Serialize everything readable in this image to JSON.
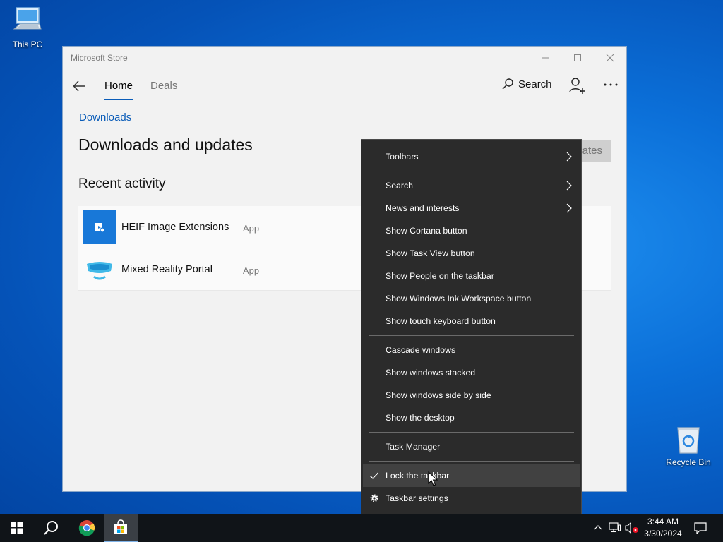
{
  "desktop": {
    "icons": [
      {
        "label": "This PC"
      },
      {
        "label": "Recycle Bin"
      }
    ]
  },
  "store": {
    "window_title": "Microsoft Store",
    "nav": {
      "tabs": [
        {
          "label": "Home",
          "active": true
        },
        {
          "label": "Deals",
          "active": false
        }
      ],
      "search_label": "Search"
    },
    "breadcrumb": "Downloads",
    "page_title": "Downloads and updates",
    "updates_button_partial": "lates",
    "recent_title": "Recent activity",
    "recent_items": [
      {
        "name": "HEIF Image Extensions",
        "type": "App",
        "icon": "heif-app-icon"
      },
      {
        "name": "Mixed Reality Portal",
        "type": "App",
        "icon": "mixed-reality-icon"
      }
    ],
    "colors": {
      "accent": "#0a5cb8",
      "tile_blue": "#1878d8"
    }
  },
  "context_menu": {
    "items": [
      {
        "label": "Toolbars",
        "submenu": true
      },
      {
        "label": "Search",
        "submenu": true
      },
      {
        "label": "News and interests",
        "submenu": true
      },
      {
        "label": "Show Cortana button"
      },
      {
        "label": "Show Task View button"
      },
      {
        "label": "Show People on the taskbar"
      },
      {
        "label": "Show Windows Ink Workspace button"
      },
      {
        "label": "Show touch keyboard button"
      },
      {
        "label": "Cascade windows"
      },
      {
        "label": "Show windows stacked"
      },
      {
        "label": "Show windows side by side"
      },
      {
        "label": "Show the desktop"
      },
      {
        "label": "Task Manager"
      },
      {
        "label": "Lock the taskbar",
        "checked": true,
        "highlighted": true
      },
      {
        "label": "Taskbar settings",
        "icon": "gear-icon"
      }
    ]
  },
  "taskbar": {
    "apps": [
      "start-icon",
      "search-icon",
      "chrome-icon",
      "store-icon"
    ],
    "clock": {
      "time": "3:44 AM",
      "date": "3/30/2024"
    }
  }
}
